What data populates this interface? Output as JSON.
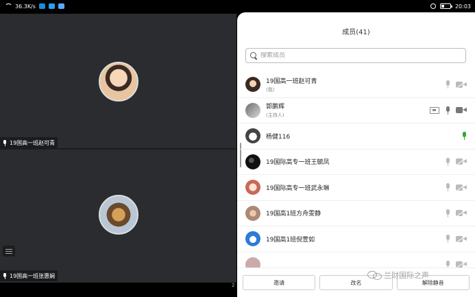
{
  "statusbar": {
    "speed": "36.3K/s",
    "time": "20:03",
    "battery_level": 0.3
  },
  "video_panes": [
    {
      "name": "19国高一班赵可青"
    },
    {
      "name": "19国高一班张惠娴"
    }
  ],
  "corner_number": "2",
  "panel": {
    "title": "成员(41)",
    "search_placeholder": "搜索成员",
    "members": [
      {
        "name": "19国高一班赵可青",
        "sub": "(我)",
        "avatar": "av1",
        "share": false,
        "mic_color": "#bbbbbb",
        "mic": true,
        "cam": "off"
      },
      {
        "name": "郭鹏辉",
        "sub": "(主持人)",
        "avatar": "av2",
        "share": true,
        "mic_color": "#777777",
        "mic": true,
        "cam": "on"
      },
      {
        "name": "杨健116",
        "sub": "",
        "avatar": "av3",
        "share": false,
        "mic_color": "#33aa33",
        "mic": true,
        "cam": "none"
      },
      {
        "name": "19国际高专一班王毓凤",
        "sub": "",
        "avatar": "av4",
        "share": false,
        "mic_color": "#bbbbbb",
        "mic": true,
        "cam": "off"
      },
      {
        "name": "19国际高专一班武永琳",
        "sub": "",
        "avatar": "av5",
        "share": false,
        "mic_color": "#bbbbbb",
        "mic": true,
        "cam": "off"
      },
      {
        "name": "19国高1班方舟雯静",
        "sub": "",
        "avatar": "av6",
        "share": false,
        "mic_color": "#bbbbbb",
        "mic": true,
        "cam": "off"
      },
      {
        "name": "19国高1班倪萱如",
        "sub": "",
        "avatar": "av7",
        "share": false,
        "mic_color": "#bbbbbb",
        "mic": true,
        "cam": "off"
      },
      {
        "name": "",
        "sub": "",
        "avatar": "av8",
        "share": false,
        "mic_color": "#bbbbbb",
        "mic": true,
        "cam": "off"
      }
    ],
    "footer": {
      "invite": "邀请",
      "rename": "改名",
      "third": "解除静音"
    }
  },
  "watermark": "兰财国际之声"
}
